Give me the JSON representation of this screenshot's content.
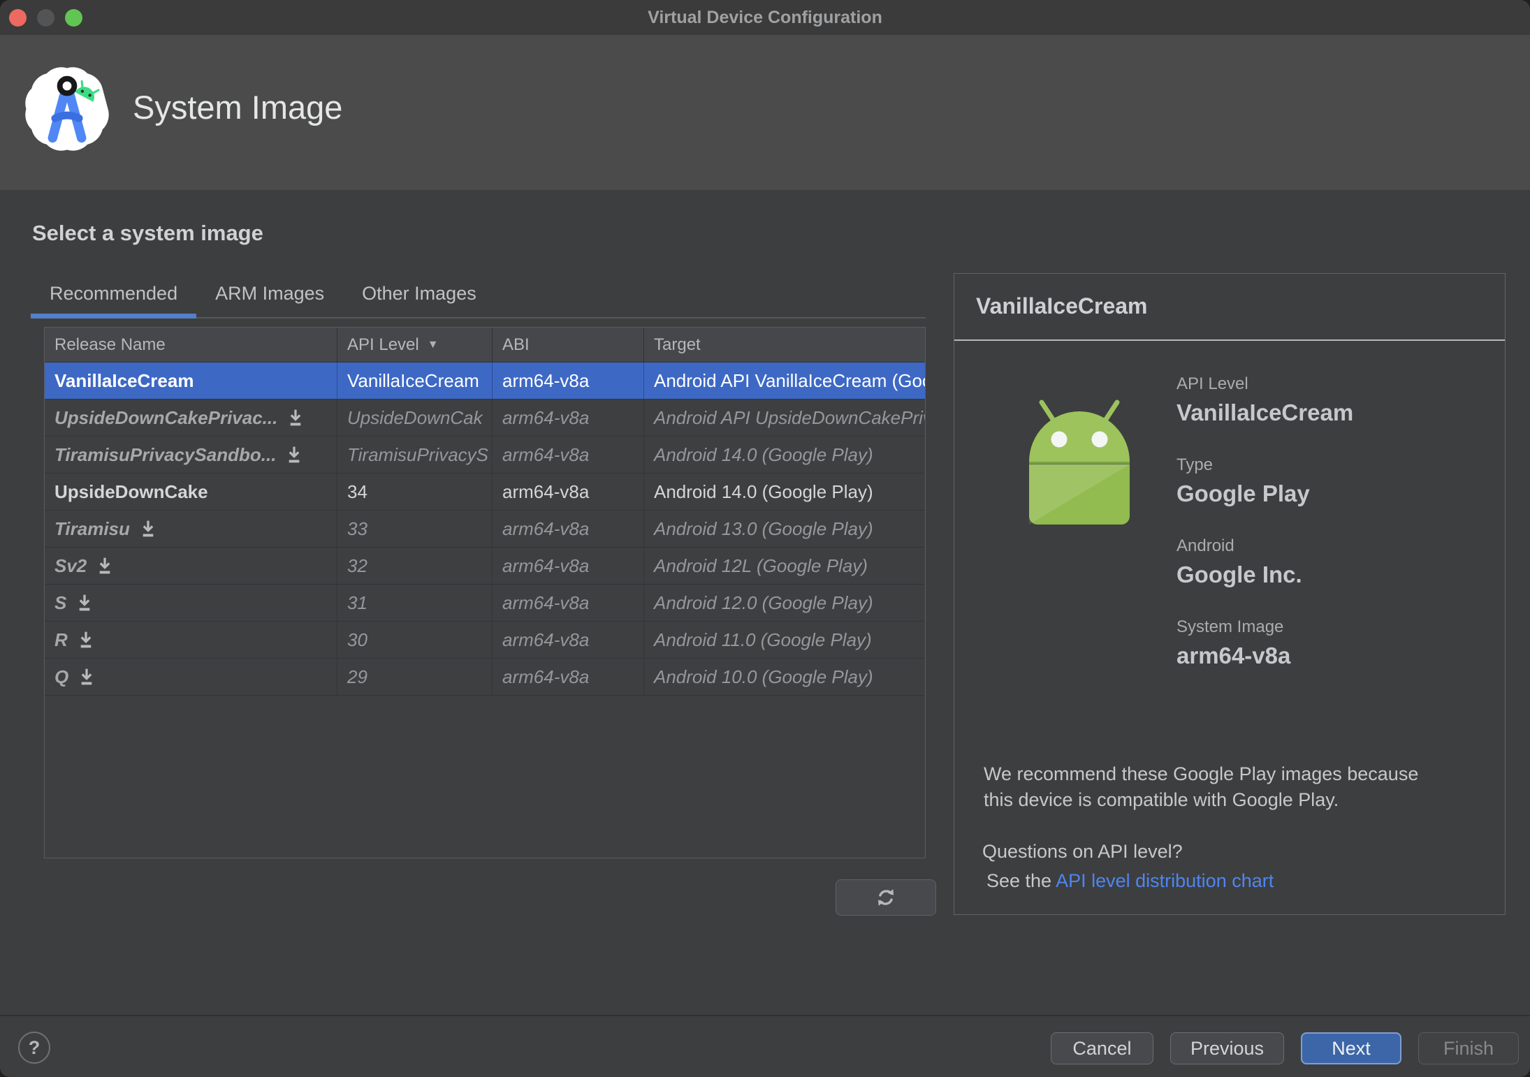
{
  "window": {
    "title": "Virtual Device Configuration"
  },
  "header": {
    "title": "System Image"
  },
  "section": {
    "title": "Select a system image"
  },
  "tabs": [
    {
      "label": "Recommended",
      "active": true
    },
    {
      "label": "ARM Images",
      "active": false
    },
    {
      "label": "Other Images",
      "active": false
    }
  ],
  "table": {
    "columns": [
      {
        "label": "Release Name"
      },
      {
        "label": "API Level",
        "sort": "desc"
      },
      {
        "label": "ABI"
      },
      {
        "label": "Target"
      }
    ],
    "rows": [
      {
        "release": "VanillaIceCream",
        "api": "VanillaIceCream",
        "abi": "arm64-v8a",
        "target": "Android API VanillaIceCream (Goo",
        "state": "selected",
        "download": false
      },
      {
        "release": "UpsideDownCakePrivac...",
        "api": "UpsideDownCak",
        "abi": "arm64-v8a",
        "target": "Android API UpsideDownCakePriv",
        "state": "remote",
        "download": true
      },
      {
        "release": "TiramisuPrivacySandbo...",
        "api": "TiramisuPrivacyS",
        "abi": "arm64-v8a",
        "target": "Android 14.0 (Google Play)",
        "state": "remote",
        "download": true
      },
      {
        "release": "UpsideDownCake",
        "api": "34",
        "abi": "arm64-v8a",
        "target": "Android 14.0 (Google Play)",
        "state": "installed",
        "download": false
      },
      {
        "release": "Tiramisu",
        "api": "33",
        "abi": "arm64-v8a",
        "target": "Android 13.0 (Google Play)",
        "state": "remote",
        "download": true
      },
      {
        "release": "Sv2",
        "api": "32",
        "abi": "arm64-v8a",
        "target": "Android 12L (Google Play)",
        "state": "remote",
        "download": true
      },
      {
        "release": "S",
        "api": "31",
        "abi": "arm64-v8a",
        "target": "Android 12.0 (Google Play)",
        "state": "remote",
        "download": true
      },
      {
        "release": "R",
        "api": "30",
        "abi": "arm64-v8a",
        "target": "Android 11.0 (Google Play)",
        "state": "remote",
        "download": true
      },
      {
        "release": "Q",
        "api": "29",
        "abi": "arm64-v8a",
        "target": "Android 10.0 (Google Play)",
        "state": "remote",
        "download": true
      }
    ]
  },
  "details_panel": {
    "title": "VanillaIceCream",
    "items": [
      {
        "label": "API Level",
        "value": "VanillaIceCream"
      },
      {
        "label": "Type",
        "value": "Google Play"
      },
      {
        "label": "Android",
        "value": "Google Inc."
      },
      {
        "label": "System Image",
        "value": "arm64-v8a"
      }
    ],
    "note": "We recommend these Google Play images because this device is compatible with Google Play.",
    "question": "Questions on API level?",
    "see_prefix": "See the ",
    "link_label": "API level distribution chart"
  },
  "footer": {
    "help_label": "?",
    "buttons": [
      {
        "label": "Cancel",
        "style": "default"
      },
      {
        "label": "Previous",
        "style": "default"
      },
      {
        "label": "Next",
        "style": "primary"
      },
      {
        "label": "Finish",
        "style": "disabled"
      }
    ]
  },
  "colors": {
    "selection_blue": "#3d69c5",
    "primary_button_blue": "#3c66a8",
    "tab_accent_blue": "#5380c8",
    "link_blue": "#4d86f0",
    "android_green": "#9cc25e",
    "traffic_red": "#ec6a5f",
    "traffic_green": "#61c554"
  }
}
